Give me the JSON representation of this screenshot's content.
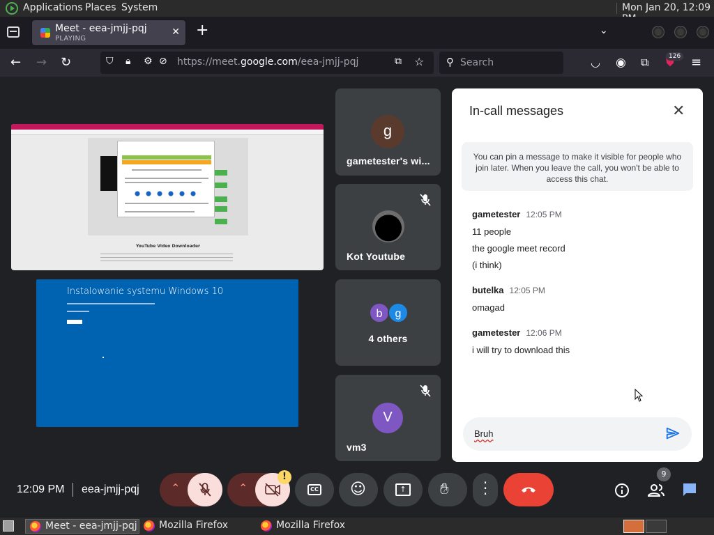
{
  "top_panel": {
    "menus": [
      "Applications",
      "Places",
      "System"
    ],
    "clock": "Mon Jan 20, 12:09 PM"
  },
  "browser": {
    "tab": {
      "title": "Meet - eea-jmjj-pqj",
      "status": "PLAYING"
    },
    "url_prefix": "https://meet.",
    "url_host": "google.com",
    "url_path": "/eea-jmjj-pqj",
    "search_placeholder": "Search",
    "extension_badge": "126"
  },
  "meet": {
    "screen_share_windows_title": "Instalowanie systemu Windows 10",
    "screen_share_page_heading": "YouTube Video Downloader",
    "participants": [
      {
        "name": "gametester's wi...",
        "initial": "g",
        "avatar_color": "#5b3a2e",
        "muted": false
      },
      {
        "name": "Kot Youtube",
        "initial": "",
        "avatar_color": "#1a1a1a",
        "muted": true
      },
      {
        "name": "4 others",
        "initial": "",
        "avatar_color": "",
        "muted": false,
        "mini_initials": [
          "b",
          "g"
        ],
        "mini_colors": [
          "#7e57c2",
          "#1e88e5"
        ]
      },
      {
        "name": "vm3",
        "initial": "V",
        "avatar_color": "#7e57c2",
        "muted": true
      }
    ],
    "chat": {
      "title": "In-call messages",
      "pin_note": "You can pin a message to make it visible for people who join later. When you leave the call, you won't be able to access this chat.",
      "messages": [
        {
          "sender": "gametester",
          "time": "12:05 PM",
          "lines": [
            "11 people",
            "the google meet record",
            "(i think)"
          ]
        },
        {
          "sender": "butelka",
          "time": "12:05 PM",
          "lines": [
            "omagad"
          ]
        },
        {
          "sender": "gametester",
          "time": "12:06 PM",
          "lines": [
            "i will try to download this"
          ]
        }
      ],
      "input_value": "Bruh"
    },
    "controls": {
      "time": "12:09 PM",
      "meeting_code": "eea-jmjj-pqj",
      "warning_badge": "!",
      "people_count": "9"
    }
  },
  "taskbar": {
    "tasks": [
      "Meet - eea-jmjj-pqj ...",
      "Mozilla Firefox",
      "Mozilla Firefox"
    ]
  },
  "colors": {
    "meet_bg": "#202124",
    "tile_bg": "#3c4043",
    "end_call": "#ea4335",
    "muted_bg": "#f28b82",
    "chat_accent": "#1a73e8"
  }
}
